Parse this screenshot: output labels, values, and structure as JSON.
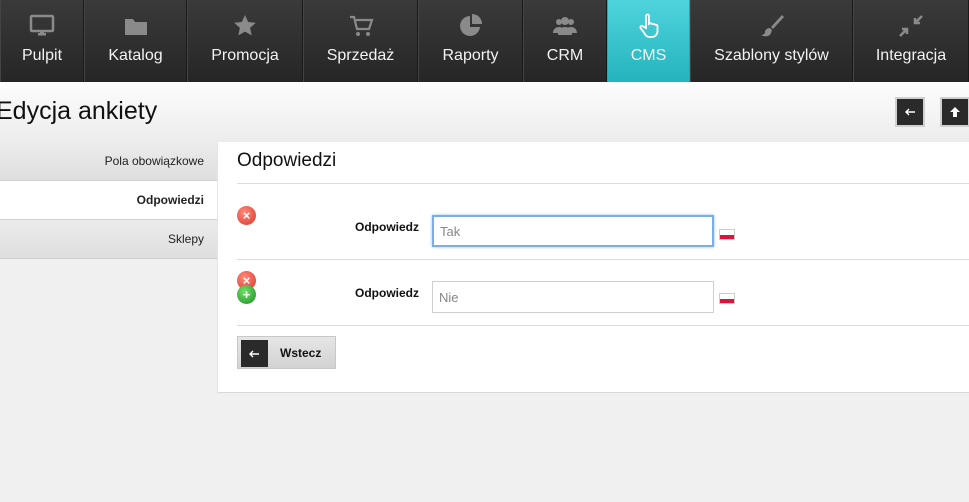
{
  "nav": {
    "items": [
      {
        "label": "Pulpit",
        "icon": "monitor-icon"
      },
      {
        "label": "Katalog",
        "icon": "folder-icon"
      },
      {
        "label": "Promocja",
        "icon": "star-icon"
      },
      {
        "label": "Sprzedaż",
        "icon": "cart-icon"
      },
      {
        "label": "Raporty",
        "icon": "pie-chart-icon"
      },
      {
        "label": "CRM",
        "icon": "users-icon"
      },
      {
        "label": "CMS",
        "icon": "pointer-hand-icon",
        "active": true
      },
      {
        "label": "Szablony stylów",
        "icon": "brush-icon"
      },
      {
        "label": "Integracja",
        "icon": "compress-arrows-icon"
      }
    ]
  },
  "header": {
    "title": "Edycja ankiety"
  },
  "sidebar": {
    "items": [
      {
        "label": "Pola obowiązkowe"
      },
      {
        "label": "Odpowiedzi",
        "active": true
      },
      {
        "label": "Sklepy"
      }
    ]
  },
  "main": {
    "title": "Odpowiedzi",
    "answers": [
      {
        "label": "Odpowiedz",
        "value": "Tak",
        "flag": "pl"
      },
      {
        "label": "Odpowiedz",
        "value": "Nie",
        "flag": "pl"
      }
    ],
    "back_label": "Wstecz"
  },
  "colors": {
    "accent": "#2fc0ca",
    "nav_bg": "#2e2e2e",
    "delete": "#e0463a",
    "add": "#2a9e2e"
  }
}
